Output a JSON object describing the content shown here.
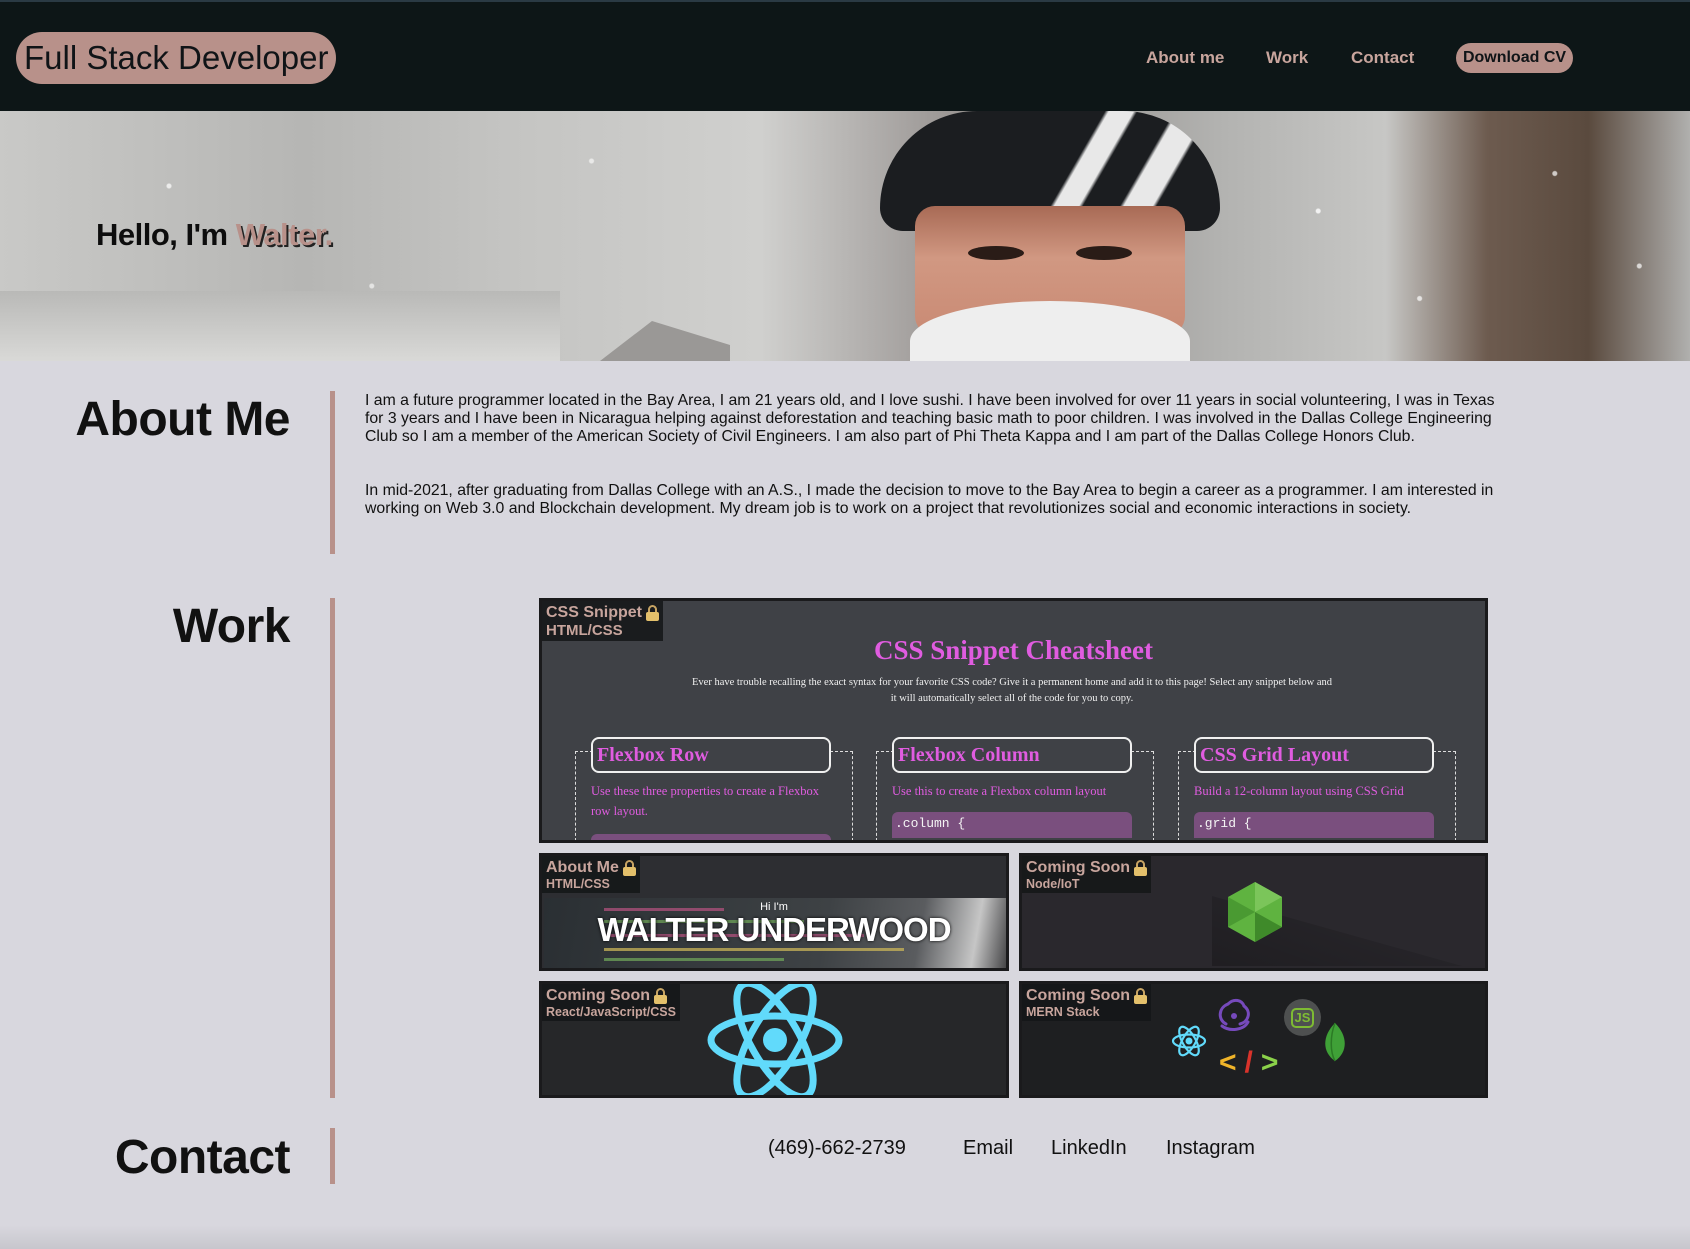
{
  "header": {
    "brand": "Full Stack Developer",
    "nav": [
      "About me",
      "Work",
      "Contact"
    ],
    "cv_button": "Download CV"
  },
  "hero": {
    "greeting": "Hello, I'm ",
    "name": "Walter."
  },
  "about": {
    "title": "About Me",
    "paragraphs": [
      "I am a future programmer located in the Bay Area, I am 21 years old, and I love sushi. I have been involved for over 11 years in social volunteering, I was in Texas for 3 years and I have been in Nicaragua helping against deforestation and teaching basic math to poor children. I was involved in the Dallas College Engineering Club so I am a member of the American Society of Civil Engineers. I am also part of Phi Theta Kappa and I am part of the Dallas College Honors Club.",
      "In mid-2021, after graduating from Dallas College with an A.S., I made the decision to move to the Bay Area to begin a career as a programmer. I am interested in working on Web 3.0 and Blockchain development. My dream job is to work on a project that revolutionizes social and economic interactions in society."
    ]
  },
  "work": {
    "title": "Work",
    "projects": [
      {
        "name": "CSS Snippet",
        "tech": "HTML/CSS"
      },
      {
        "name": "About Me",
        "tech": "HTML/CSS"
      },
      {
        "name": "Coming Soon",
        "tech": "Node/IoT"
      },
      {
        "name": "Coming Soon",
        "tech": "React/JavaScript/CSS"
      },
      {
        "name": "Coming Soon",
        "tech": "MERN Stack"
      }
    ],
    "css_preview": {
      "title": "CSS Snippet Cheatsheet",
      "description": "Ever have trouble recalling the exact syntax for your favorite CSS code? Give it a permanent home and add it to this page! Select any snippet below and it will automatically select all of the code for you to copy.",
      "snippets": [
        {
          "title": "Flexbox Row",
          "desc": "Use these three properties to create a Flexbox row layout.",
          "code": ""
        },
        {
          "title": "Flexbox Column",
          "desc": "Use this to create a Flexbox column layout",
          "code": ".column {"
        },
        {
          "title": "CSS Grid Layout",
          "desc": "Build a 12-column layout using CSS Grid",
          "code": ".grid {"
        }
      ]
    },
    "about_preview": {
      "hi": "Hi I'm",
      "name": "WALTER UNDERWOOD"
    },
    "mern_preview": {
      "code_open": "<",
      "code_slash": "/",
      "code_close": ">",
      "node_badge": "JS"
    }
  },
  "contact": {
    "title": "Contact",
    "links": [
      "(469)-662-2739",
      "Email",
      "LinkedIn",
      "Instagram"
    ]
  },
  "colors": {
    "accent": "#b8918a",
    "header_bg": "#0d1617",
    "page_bg": "#d8d7de",
    "css_title": "#e05ce0",
    "react_blue": "#61dafb",
    "node_green": "#5fb340"
  }
}
